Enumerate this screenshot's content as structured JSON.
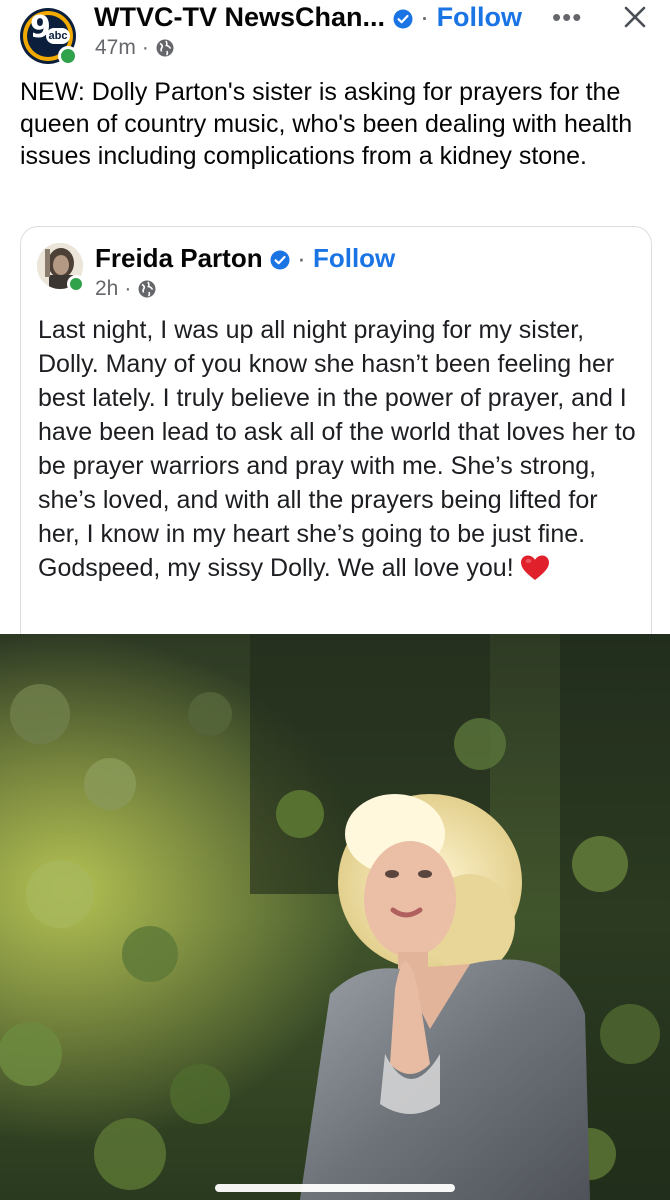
{
  "post": {
    "page_name": "WTVC-TV NewsChan...",
    "follow_label": "Follow",
    "separator": "·",
    "time": "47m",
    "more_label": "•••",
    "body": "NEW: Dolly Parton's sister is asking for prayers for the queen of country music, who's been dealing with health issues including complications from a kidney stone."
  },
  "shared": {
    "author": "Freida Parton",
    "follow_label": "Follow",
    "separator": "·",
    "time": "2h",
    "body": "Last night, I was up all night praying for my sister, Dolly. Many of you know she hasn’t been feeling her best lately. I truly believe in the power of prayer, and I have been lead to ask all of the world that loves her to be prayer warriors and pray with me. She’s strong, she’s loved, and with all the prayers being lifted for her, I know in my heart she’s going to be just fine. Godspeed, my sissy Dolly. We all love you!"
  },
  "avatar_logo": {
    "number": "9",
    "network": "abc"
  },
  "colors": {
    "accent": "#1b74e4",
    "online": "#31a24c",
    "muted": "#65676b",
    "heart": "#e0202b"
  },
  "icons": [
    "verified-badge-icon",
    "globe-icon",
    "more-options-icon",
    "close-icon",
    "red-heart-icon"
  ]
}
